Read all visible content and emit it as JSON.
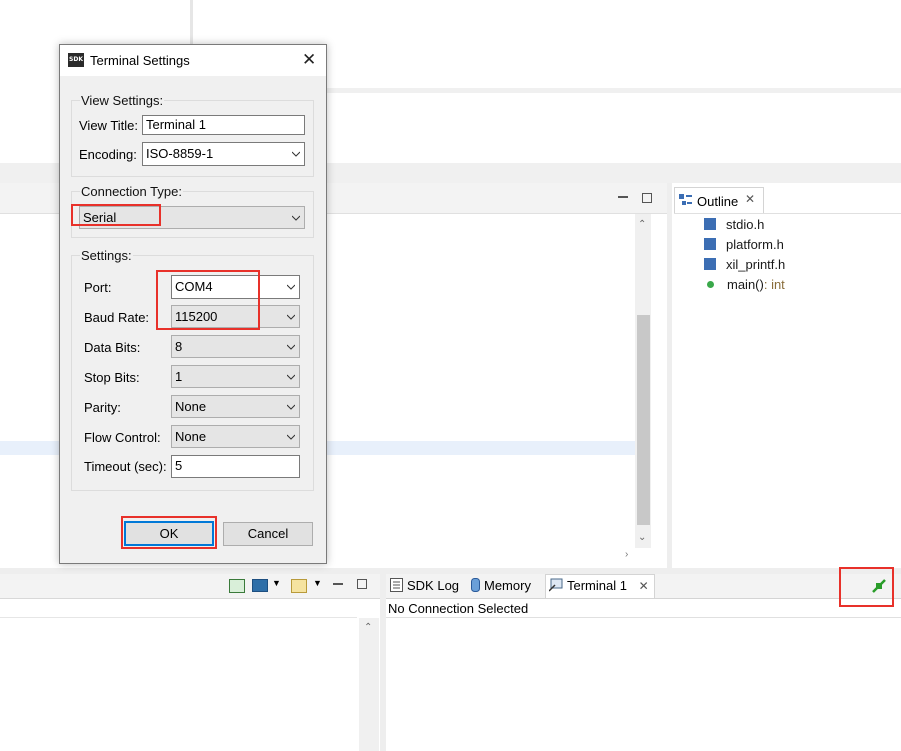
{
  "dialog": {
    "logo_text": "SDK",
    "title": "Terminal Settings",
    "view_settings": {
      "group_label": "View Settings:",
      "view_title_label": "View Title:",
      "view_title_value": "Terminal 1",
      "encoding_label": "Encoding:",
      "encoding_value": "ISO-8859-1"
    },
    "connection_type": {
      "group_label": "Connection Type:",
      "value": "Serial"
    },
    "settings": {
      "group_label": "Settings:",
      "port_label": "Port:",
      "port_value": "COM4",
      "baud_label": "Baud Rate:",
      "baud_value": "115200",
      "data_bits_label": "Data Bits:",
      "data_bits_value": "8",
      "stop_bits_label": "Stop Bits:",
      "stop_bits_value": "1",
      "parity_label": "Parity:",
      "parity_value": "None",
      "flow_label": "Flow Control:",
      "flow_value": "None",
      "timeout_label": "Timeout (sec):",
      "timeout_value": "5"
    },
    "ok_label": "OK",
    "cancel_label": "Cancel"
  },
  "outline": {
    "tab_label": "Outline",
    "items": [
      {
        "label": "stdio.h",
        "icon": "include-icon"
      },
      {
        "label": "platform.h",
        "icon": "include-icon"
      },
      {
        "label": "xil_printf.h",
        "icon": "include-icon"
      },
      {
        "label": "main()",
        "type": ": int",
        "icon": "function-icon"
      }
    ]
  },
  "bottom_tabs": {
    "sdk_log": "SDK Log",
    "memory": "Memory",
    "terminal": "Terminal 1"
  },
  "terminal_status": "No Connection Selected",
  "colors": {
    "highlight": "#e8312a",
    "accent": "#0078d7",
    "connect_icon": "#2a9d2a"
  }
}
